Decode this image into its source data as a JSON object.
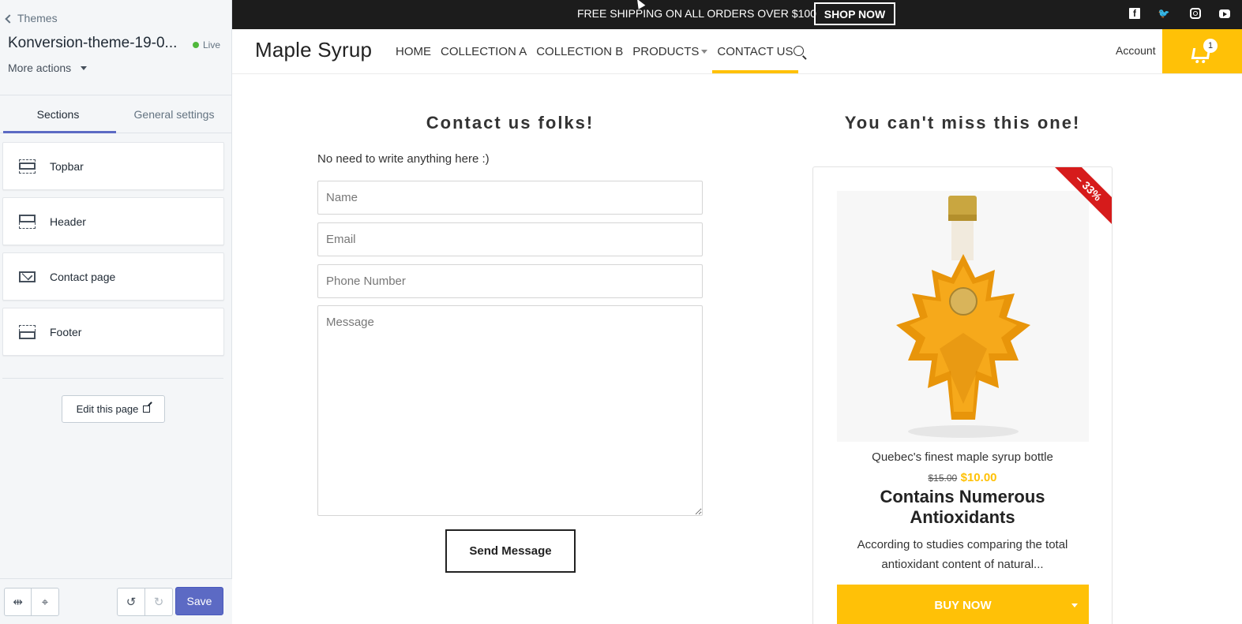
{
  "editor": {
    "back_label": "Themes",
    "theme_title": "Konversion-theme-19-0...",
    "status": "Live",
    "more_actions": "More actions",
    "tabs": [
      {
        "label": "Sections"
      },
      {
        "label": "General settings"
      }
    ],
    "sections": [
      {
        "label": "Topbar",
        "icon": "topbar-icon"
      },
      {
        "label": "Header",
        "icon": "header-icon"
      },
      {
        "label": "Contact page",
        "icon": "mail-icon"
      },
      {
        "label": "Footer",
        "icon": "footer-icon"
      }
    ],
    "edit_page_label": "Edit this page",
    "save_label": "Save",
    "accent_color": "#5c6ac4"
  },
  "store": {
    "topbar": {
      "promo_text": "FREE SHIPPING ON ALL ORDERS OVER $100",
      "cta_label": "SHOP NOW"
    },
    "header": {
      "logo": "Maple Syrup",
      "nav": [
        {
          "label": "HOME"
        },
        {
          "label": "COLLECTION A"
        },
        {
          "label": "COLLECTION B"
        },
        {
          "label": "PRODUCTS"
        },
        {
          "label": "CONTACT US"
        }
      ],
      "account_label": "Account",
      "cart_count": "1",
      "accent_color": "#ffc107"
    },
    "contact": {
      "title": "Contact us folks!",
      "subtitle": "No need to write anything here :)",
      "name_placeholder": "Name",
      "email_placeholder": "Email",
      "phone_placeholder": "Phone Number",
      "message_placeholder": "Message",
      "send_label": "Send Message"
    },
    "promo": {
      "title": "You can't miss this one!",
      "badge": "– 33%",
      "product_name": "Quebec's finest maple syrup bottle",
      "old_price": "$15.00",
      "new_price": "$10.00",
      "headline": "Contains Numerous Antioxidants",
      "description": "According to studies comparing the total antioxidant content of natural...",
      "buy_label": "BUY NOW",
      "badge_color": "#d61b1b"
    }
  }
}
